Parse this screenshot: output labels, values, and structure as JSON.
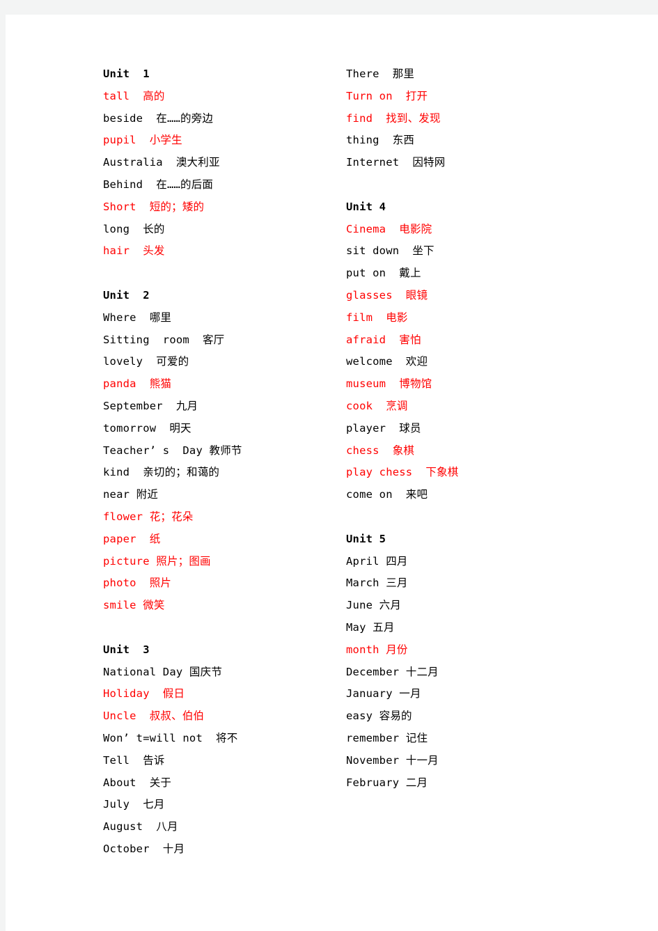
{
  "page": {
    "background_color": "#f3f4f4",
    "paper_color": "#ffffff",
    "text_color": "#000000",
    "accent_color": "#ff0000"
  },
  "columns": [
    {
      "name": "left-column",
      "lines": [
        {
          "text": "Unit  1",
          "color": "black",
          "style": "unit"
        },
        {
          "text": "tall  高的",
          "color": "red",
          "style": "entry"
        },
        {
          "text": "beside  在……的旁边",
          "color": "black",
          "style": "entry"
        },
        {
          "text": "pupil  小学生",
          "color": "red",
          "style": "entry"
        },
        {
          "text": "Australia  澳大利亚",
          "color": "black",
          "style": "entry"
        },
        {
          "text": "Behind  在……的后面",
          "color": "black",
          "style": "entry"
        },
        {
          "text": "Short  短的；矮的",
          "color": "red",
          "style": "entry"
        },
        {
          "text": "long  长的",
          "color": "black",
          "style": "entry"
        },
        {
          "text": "hair  头发",
          "color": "red",
          "style": "entry"
        },
        {
          "text": "",
          "color": "black",
          "style": "blank"
        },
        {
          "text": "Unit  2",
          "color": "black",
          "style": "unit"
        },
        {
          "text": "Where  哪里",
          "color": "black",
          "style": "entry"
        },
        {
          "text": "Sitting  room  客厅",
          "color": "black",
          "style": "entry"
        },
        {
          "text": "lovely  可爱的",
          "color": "black",
          "style": "entry"
        },
        {
          "text": "panda  熊猫",
          "color": "red",
          "style": "entry"
        },
        {
          "text": "September  九月",
          "color": "black",
          "style": "entry"
        },
        {
          "text": "tomorrow  明天",
          "color": "black",
          "style": "entry"
        },
        {
          "text": "Teacher’ s  Day 教师节",
          "color": "black",
          "style": "entry"
        },
        {
          "text": "kind  亲切的；和蔼的",
          "color": "black",
          "style": "entry"
        },
        {
          "text": "near 附近",
          "color": "black",
          "style": "entry"
        },
        {
          "text": "flower 花；花朵",
          "color": "red",
          "style": "entry"
        },
        {
          "text": "paper  纸",
          "color": "red",
          "style": "entry"
        },
        {
          "text": "picture 照片；图画",
          "color": "red",
          "style": "entry"
        },
        {
          "text": "photo  照片",
          "color": "red",
          "style": "entry"
        },
        {
          "text": "smile 微笑",
          "color": "red",
          "style": "entry"
        },
        {
          "text": "",
          "color": "black",
          "style": "blank"
        },
        {
          "text": "Unit  3",
          "color": "black",
          "style": "unit"
        },
        {
          "text": "National Day 国庆节",
          "color": "black",
          "style": "entry"
        },
        {
          "text": "Holiday  假日",
          "color": "red",
          "style": "entry"
        },
        {
          "text": "Uncle  叔叔、伯伯",
          "color": "red",
          "style": "entry"
        },
        {
          "text": "Won’ t=will not  将不",
          "color": "black",
          "style": "entry"
        },
        {
          "text": "Tell  告诉",
          "color": "black",
          "style": "entry"
        },
        {
          "text": "About  关于",
          "color": "black",
          "style": "entry"
        },
        {
          "text": "July  七月",
          "color": "black",
          "style": "entry"
        },
        {
          "text": "August  八月",
          "color": "black",
          "style": "entry"
        },
        {
          "text": "October  十月",
          "color": "black",
          "style": "entry"
        }
      ]
    },
    {
      "name": "right-column",
      "lines": [
        {
          "text": "There  那里",
          "color": "black",
          "style": "entry"
        },
        {
          "text": "Turn on  打开",
          "color": "red",
          "style": "entry"
        },
        {
          "text": "find  找到、发现",
          "color": "red",
          "style": "entry"
        },
        {
          "text": "thing  东西",
          "color": "black",
          "style": "entry"
        },
        {
          "text": "Internet  因特网",
          "color": "black",
          "style": "entry"
        },
        {
          "text": "",
          "color": "black",
          "style": "blank"
        },
        {
          "text": "Unit 4",
          "color": "black",
          "style": "unit"
        },
        {
          "text": "Cinema  电影院",
          "color": "red",
          "style": "entry"
        },
        {
          "text": "sit down  坐下",
          "color": "black",
          "style": "entry"
        },
        {
          "text": "put on  戴上",
          "color": "black",
          "style": "entry"
        },
        {
          "text": "glasses  眼镜",
          "color": "red",
          "style": "entry"
        },
        {
          "text": "film  电影",
          "color": "red",
          "style": "entry"
        },
        {
          "text": "afraid  害怕",
          "color": "red",
          "style": "entry"
        },
        {
          "text": "welcome  欢迎",
          "color": "black",
          "style": "entry"
        },
        {
          "text": "museum  博物馆",
          "color": "red",
          "style": "entry"
        },
        {
          "text": "cook  烹调",
          "color": "red",
          "style": "entry"
        },
        {
          "text": "player  球员",
          "color": "black",
          "style": "entry"
        },
        {
          "text": "chess  象棋",
          "color": "red",
          "style": "entry"
        },
        {
          "text": "play chess  下象棋",
          "color": "red",
          "style": "entry"
        },
        {
          "text": "come on  来吧",
          "color": "black",
          "style": "entry"
        },
        {
          "text": "",
          "color": "black",
          "style": "blank"
        },
        {
          "text": "Unit 5",
          "color": "black",
          "style": "unit"
        },
        {
          "text": "April 四月",
          "color": "black",
          "style": "entry"
        },
        {
          "text": "March 三月",
          "color": "black",
          "style": "entry"
        },
        {
          "text": "June 六月",
          "color": "black",
          "style": "entry"
        },
        {
          "text": "May 五月",
          "color": "black",
          "style": "entry"
        },
        {
          "text": "month 月份",
          "color": "red",
          "style": "entry"
        },
        {
          "text": "December 十二月",
          "color": "black",
          "style": "entry"
        },
        {
          "text": "January 一月",
          "color": "black",
          "style": "entry"
        },
        {
          "text": "easy 容易的",
          "color": "black",
          "style": "entry"
        },
        {
          "text": "remember 记住",
          "color": "black",
          "style": "entry"
        },
        {
          "text": "November 十一月",
          "color": "black",
          "style": "entry"
        },
        {
          "text": "February 二月",
          "color": "black",
          "style": "entry"
        }
      ]
    }
  ]
}
